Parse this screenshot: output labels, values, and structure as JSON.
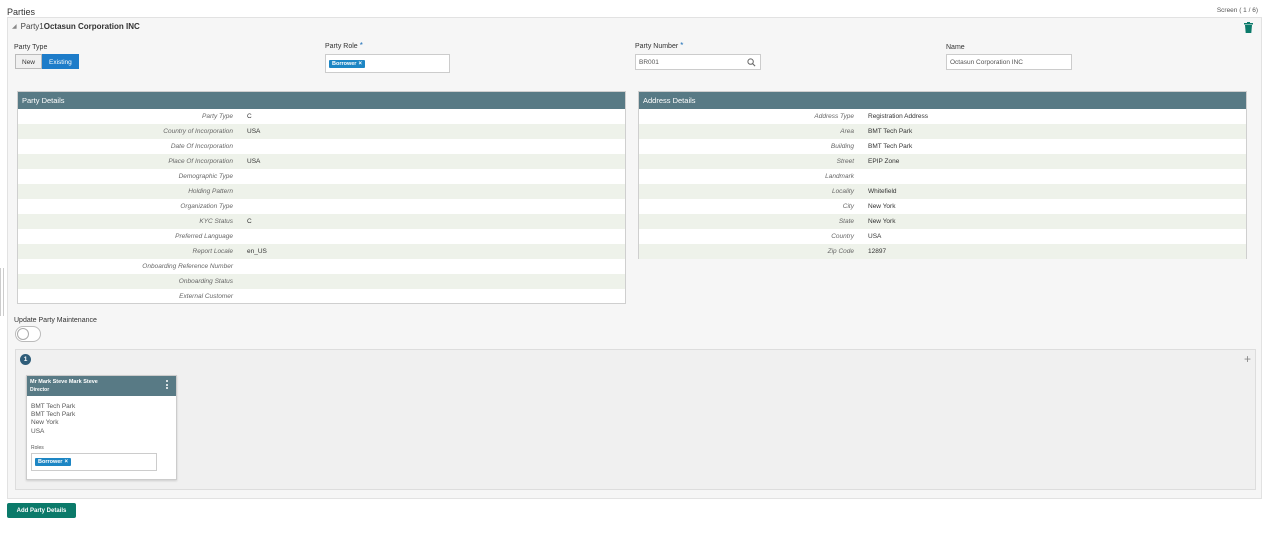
{
  "page": {
    "title": "Parties",
    "screen_indicator": "Screen ( 1 / 6)"
  },
  "party": {
    "prefix": "Party1",
    "name": "Octasun Corporation INC"
  },
  "form": {
    "party_type_label": "Party Type",
    "party_type_options": [
      "New",
      "Existing"
    ],
    "party_type_selected": "Existing",
    "party_role_label": "Party Role",
    "party_role_chip": "Borrower",
    "party_number_label": "Party Number",
    "party_number_value": "BR001",
    "name_label": "Name",
    "name_value": "Octasun Corporation INC",
    "required_mark": "*"
  },
  "party_details": {
    "title": "Party Details",
    "rows": [
      {
        "label": "Party Type",
        "value": "C"
      },
      {
        "label": "Country of Incorporation",
        "value": "USA"
      },
      {
        "label": "Date Of Incorporation",
        "value": ""
      },
      {
        "label": "Place Of Incorporation",
        "value": "USA"
      },
      {
        "label": "Demographic Type",
        "value": ""
      },
      {
        "label": "Holding Pattern",
        "value": ""
      },
      {
        "label": "Organization Type",
        "value": ""
      },
      {
        "label": "KYC Status",
        "value": "C"
      },
      {
        "label": "Preferred Language",
        "value": ""
      },
      {
        "label": "Report Locale",
        "value": "en_US"
      },
      {
        "label": "Onboarding Reference Number",
        "value": ""
      },
      {
        "label": "Onboarding Status",
        "value": ""
      },
      {
        "label": "External Customer",
        "value": ""
      }
    ]
  },
  "address_details": {
    "title": "Address Details",
    "rows": [
      {
        "label": "Address Type",
        "value": "Registration Address"
      },
      {
        "label": "Area",
        "value": "BMT Tech Park"
      },
      {
        "label": "Building",
        "value": "BMT Tech Park"
      },
      {
        "label": "Street",
        "value": "EPIP Zone"
      },
      {
        "label": "Landmark",
        "value": ""
      },
      {
        "label": "Locality",
        "value": "Whitefield"
      },
      {
        "label": "City",
        "value": "New York"
      },
      {
        "label": "State",
        "value": "New York"
      },
      {
        "label": "Country",
        "value": "USA"
      },
      {
        "label": "Zip Code",
        "value": "12897"
      }
    ]
  },
  "update_party": {
    "label": "Update Party Maintenance",
    "enabled": false
  },
  "related_parties": {
    "count": "1",
    "cards": [
      {
        "name": "Mr Mark Steve Mark Steve",
        "role": "Director",
        "address_lines": [
          "BMT Tech Park",
          "BMT Tech Park",
          "New York",
          "USA"
        ],
        "roles_label": "Roles",
        "roles_chip": "Borrower"
      }
    ]
  },
  "actions": {
    "add_party_details": "Add Party Details"
  },
  "icons": {
    "delete": "trash-icon",
    "search": "search-icon",
    "add": "plus-icon",
    "menu": "kebab-menu-icon",
    "collapse": "caret-down-icon",
    "chip_remove": "x-icon"
  },
  "colors": {
    "panel_header": "#587a85",
    "active_toggle": "#1d7cc9",
    "chip": "#1d86c4",
    "primary_button": "#0b7a6a",
    "trash": "#0b7a6a"
  }
}
